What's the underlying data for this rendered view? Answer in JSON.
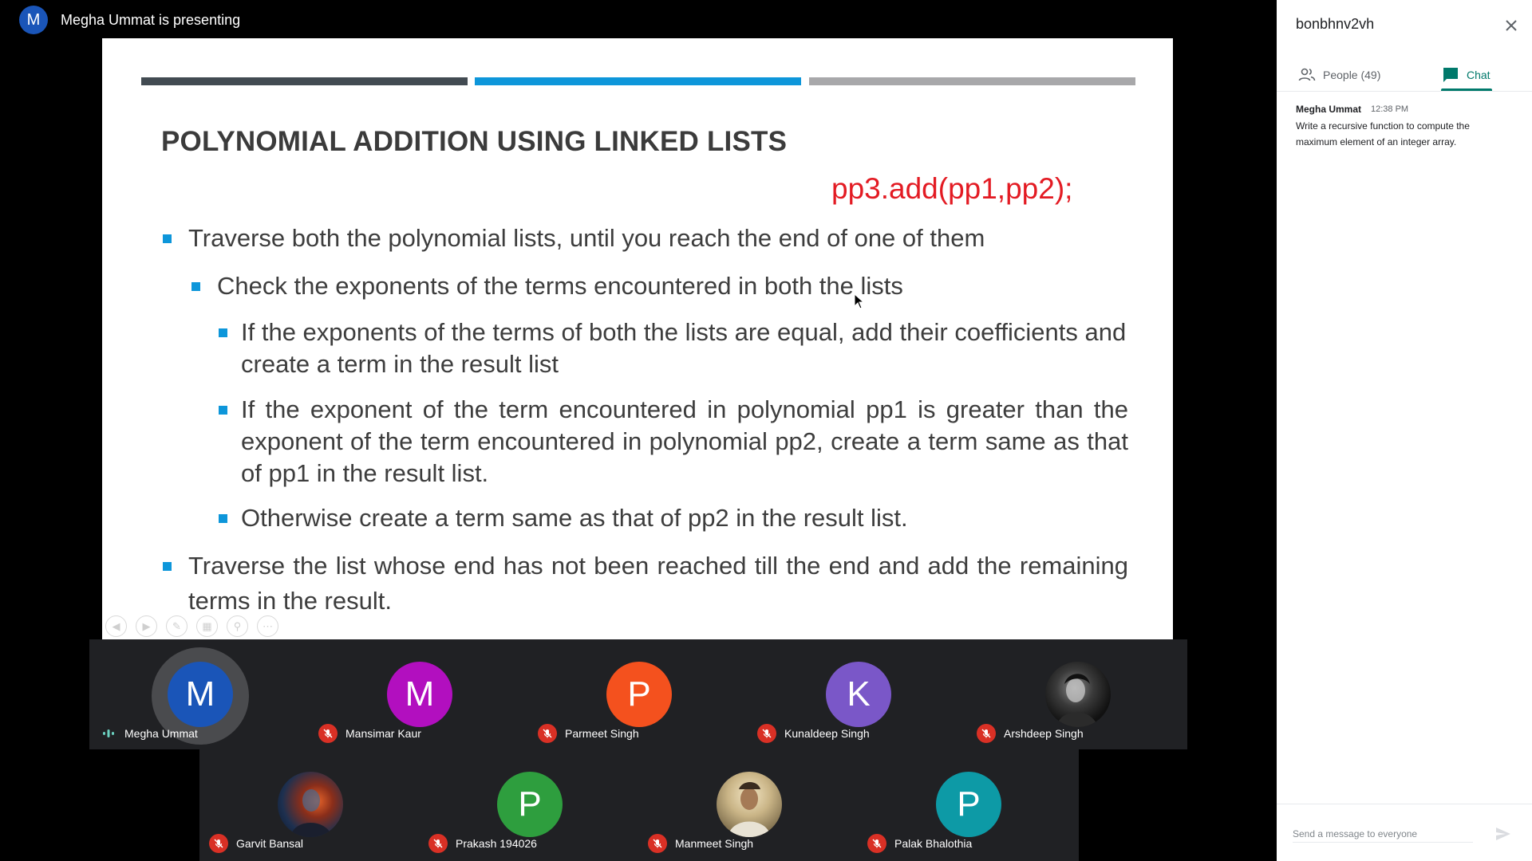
{
  "presenter": {
    "initial": "M",
    "text": "Megha Ummat is presenting"
  },
  "slide": {
    "title": "POLYNOMIAL ADDITION USING LINKED LISTS",
    "code": "pp3.add(pp1,pp2);",
    "bullets": [
      "Traverse both the polynomial lists, until you reach the end of one of them",
      "Check the exponents of the terms encountered in both the lists",
      "If the exponents of the terms of both the lists are equal, add their coefficients and create a term in the result list",
      "If the exponent of the term encountered in polynomial pp1 is greater than the exponent of the term encountered in polynomial pp2, create a term same as that of pp1 in the result list.",
      "Otherwise create a term same as that of pp2 in the result list.",
      "Traverse the list whose end has not been reached till the end and add the remaining terms in the result."
    ],
    "colors": {
      "stripe_dark": "#424b52",
      "stripe_blue": "#0d96da",
      "stripe_gray": "#a8a8aa",
      "code": "#e31b23"
    }
  },
  "participants": [
    {
      "name": "Megha Ummat",
      "initial": "M",
      "color": "#1a55b8",
      "mic": "speaking"
    },
    {
      "name": "Mansimar Kaur",
      "initial": "M",
      "color": "#b20fbf",
      "mic": "muted"
    },
    {
      "name": "Parmeet Singh",
      "initial": "P",
      "color": "#f4511e",
      "mic": "muted"
    },
    {
      "name": "Kunaldeep Singh",
      "initial": "K",
      "color": "#7a57c8",
      "mic": "muted"
    },
    {
      "name": "Arshdeep Singh",
      "initial": "",
      "color": "#1a1a1a",
      "mic": "muted",
      "photo": true
    },
    {
      "name": "Garvit Bansal",
      "initial": "",
      "color": "#3a4a66",
      "mic": "muted",
      "photo": true
    },
    {
      "name": "Prakash 194026",
      "initial": "P",
      "color": "#2e9e3e",
      "mic": "muted"
    },
    {
      "name": "Manmeet Singh",
      "initial": "",
      "color": "#9a8a6a",
      "mic": "muted",
      "photo": true
    },
    {
      "name": "Palak Bhalothia",
      "initial": "P",
      "color": "#0d9aa6",
      "mic": "muted"
    }
  ],
  "panel": {
    "title": "bonbhnv2vh",
    "tab_people": "People (49)",
    "tab_chat": "Chat",
    "active_tab": "Chat",
    "message": {
      "sender": "Megha Ummat",
      "time": "12:38 PM",
      "text": "Write a recursive function to compute the maximum element of an integer array."
    },
    "composer_placeholder": "Send a message to everyone",
    "accent": "#00796b"
  }
}
